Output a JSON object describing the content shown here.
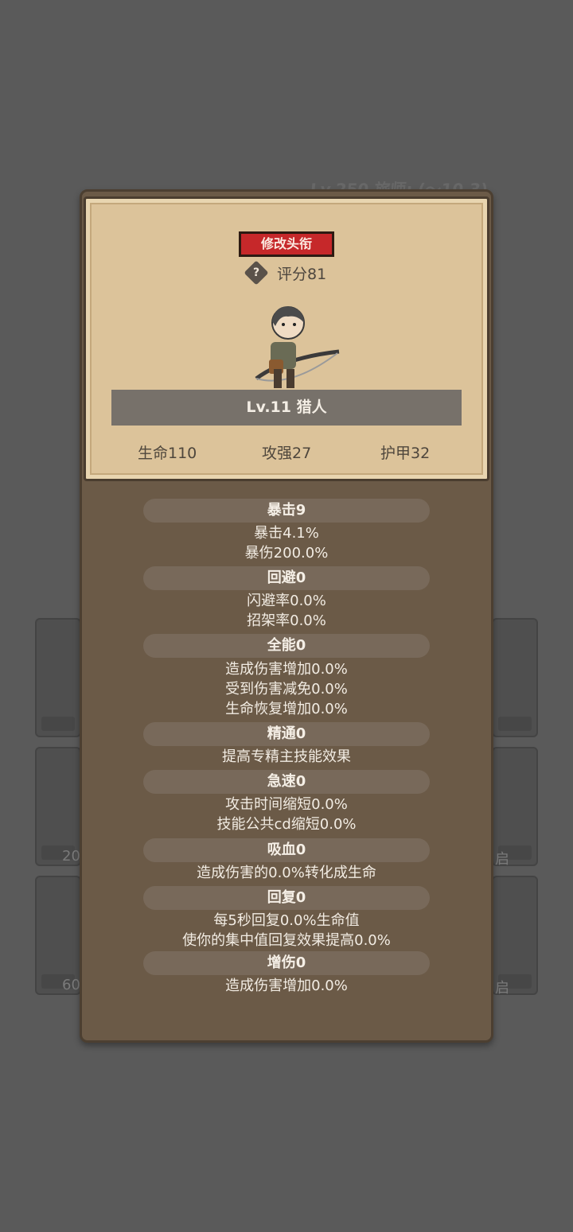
{
  "background": {
    "title_fragment": "Lv.250 旅师: (～10.3)",
    "tile_labels": [
      "20",
      "60",
      "启",
      "启"
    ]
  },
  "card": {
    "rename_label": "修改头衔",
    "help_glyph": "?",
    "score": "评分81",
    "name_bar": "Lv.11 猎人",
    "stats": {
      "hp": "生命110",
      "attack": "攻强27",
      "armor": "护甲32"
    }
  },
  "attributes": [
    {
      "head": "暴击9",
      "lines": [
        "暴击4.1%",
        "暴伤200.0%"
      ]
    },
    {
      "head": "回避0",
      "lines": [
        "闪避率0.0%",
        "招架率0.0%"
      ]
    },
    {
      "head": "全能0",
      "lines": [
        "造成伤害增加0.0%",
        "受到伤害减免0.0%",
        "生命恢复增加0.0%"
      ]
    },
    {
      "head": "精通0",
      "lines": [
        "提高专精主技能效果"
      ]
    },
    {
      "head": "急速0",
      "lines": [
        "攻击时间缩短0.0%",
        "技能公共cd缩短0.0%"
      ]
    },
    {
      "head": "吸血0",
      "lines": [
        "造成伤害的0.0%转化成生命"
      ]
    },
    {
      "head": "回复0",
      "lines": [
        "每5秒回复0.0%生命值",
        "使你的集中值回复效果提高0.0%"
      ]
    },
    {
      "head": "增伤0",
      "lines": [
        "造成伤害增加0.0%"
      ]
    }
  ],
  "colors": {
    "rename_button": "#c6282a",
    "panel": "#6b5a47",
    "card": "#dcc39a"
  },
  "icons": {
    "help": "help-diamond-icon",
    "avatar": "hunter-character-icon"
  }
}
